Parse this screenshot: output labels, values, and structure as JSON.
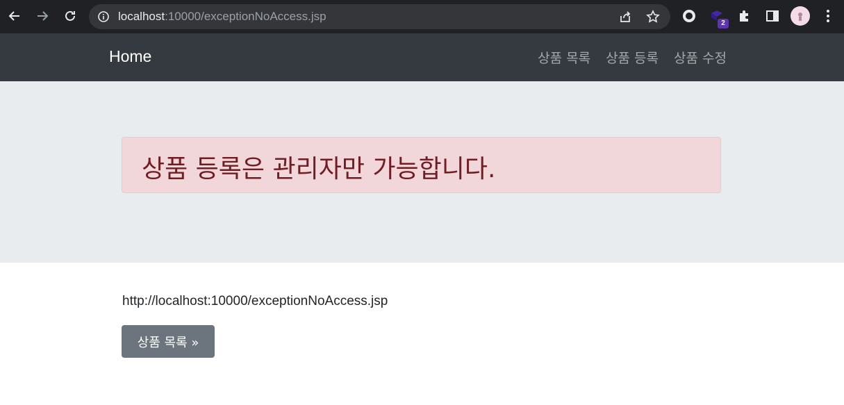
{
  "browser": {
    "url_host": "localhost",
    "url_path": ":10000/exceptionNoAccess.jsp",
    "extension_badge": "2"
  },
  "navbar": {
    "brand": "Home",
    "links": [
      "상품 목록",
      "상품 등록",
      "상품 수정"
    ]
  },
  "alert": {
    "message": "상품 등록은 관리자만 가능합니다."
  },
  "content": {
    "request_url": "http://localhost:10000/exceptionNoAccess.jsp",
    "button_label": "상품 목록 »"
  }
}
